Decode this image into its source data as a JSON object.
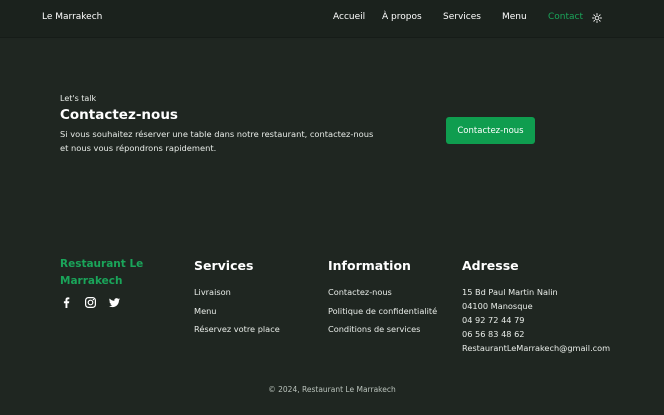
{
  "header": {
    "brand": "Le Marrakech",
    "nav": [
      "Accueil",
      "À propos",
      "Services",
      "Menu",
      "Contact"
    ],
    "active_nav": "Contact",
    "theme_icon": "sun-icon"
  },
  "cta": {
    "eyebrow": "Let's talk",
    "title": "Contactez-nous",
    "text": "Si vous souhaitez réserver une table dans notre restaurant, contactez-nous et nous vous répondrons rapidement.",
    "button": "Contactez-nous"
  },
  "footer": {
    "brand": "Restaurant Le Marrakech",
    "social_icons": [
      "facebook-icon",
      "instagram-icon",
      "twitter-icon"
    ],
    "services": {
      "title": "Services",
      "items": [
        "Livraison",
        "Menu",
        "Réservez votre place"
      ]
    },
    "information": {
      "title": "Information",
      "items": [
        "Contactez-nous",
        "Politique de confidentialité",
        "Conditions de services"
      ]
    },
    "address": {
      "title": "Adresse",
      "lines": [
        "15 Bd Paul Martin Nalin",
        "04100 Manosque",
        "04 92 72 44 79",
        "06 56 83 48 62",
        "RestaurantLeMarrakech@gmail.com"
      ]
    },
    "copyright": "© 2024, Restaurant Le Marrakech"
  },
  "colors": {
    "background": "#1f2621",
    "accent": "#1aa55a",
    "button": "#0f9d4f"
  }
}
